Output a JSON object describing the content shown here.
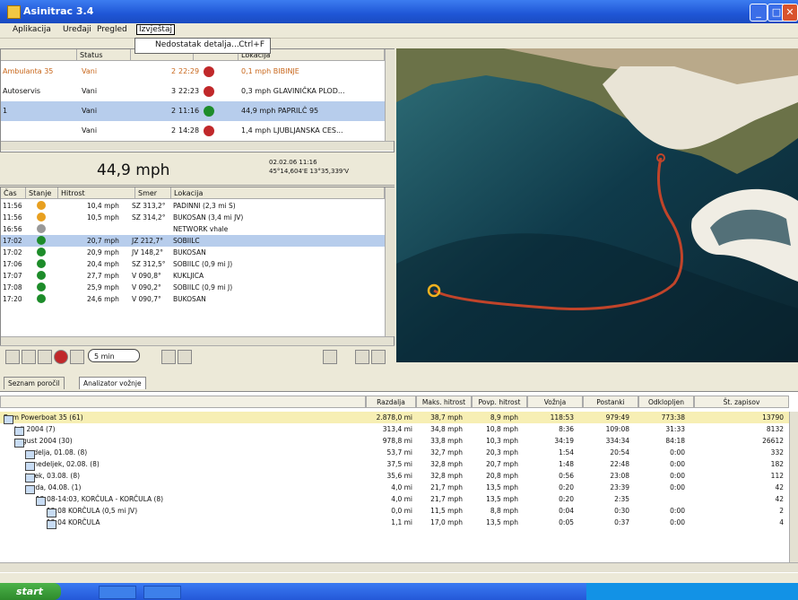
{
  "window": {
    "title": "Asinitrac 3.4"
  },
  "menu": [
    "Aplikacija",
    "Uređaji",
    "Pregled",
    "Izvještaj"
  ],
  "dropdown": {
    "item": "Nedostatak detalja...",
    "shortcut": "Ctrl+F"
  },
  "vehicles": {
    "columns": [
      "",
      "Status",
      "",
      "",
      "Lokacija"
    ],
    "rows": [
      {
        "name": "Ambulanta 35",
        "status": "Vani",
        "num": "2",
        "time": "22:29",
        "dot": "red",
        "location": "0,1 mph BIBINJE"
      },
      {
        "name": "Autoservis",
        "status": "Vani",
        "num": "3",
        "time": "22:23",
        "dot": "red",
        "location": "0,3 mph GLAVINIČKA PLOD..."
      },
      {
        "name": "1",
        "status": "Vani",
        "num": "2",
        "time": "11:16",
        "dot": "green",
        "location": "44,9 mph PAPRILČ 95"
      },
      {
        "name": "",
        "status": "Vani",
        "num": "2",
        "time": "14:28",
        "dot": "red",
        "location": "1,4 mph LJUBLJANSKA CES..."
      }
    ]
  },
  "speed_panel": {
    "speed": "44,9 mph",
    "datetime": "02.02.06 11:16",
    "coords": "45°14,604'E 13°35,339'V"
  },
  "log": {
    "columns": [
      "Čas",
      "Stanje",
      "Hitrost",
      "Smer",
      "Lokacija"
    ],
    "rows": [
      {
        "time": "11:56",
        "dot": "orange",
        "speed": "10,4 mph",
        "dir": "SZ 313,2°",
        "loc": "PADINNI (2,3 mi S)"
      },
      {
        "time": "11:56",
        "dot": "orange",
        "speed": "10,5 mph",
        "dir": "SZ 314,2°",
        "loc": "BUKOSAN (3,4 mi JV)"
      },
      {
        "time": "16:56",
        "dot": "gray",
        "speed": "",
        "dir": "",
        "loc": "NETWORK vhale"
      },
      {
        "time": "17:02",
        "dot": "green",
        "speed": "20,7 mph",
        "dir": "JZ 212,7°",
        "loc": "SOBIILC",
        "sel": true
      },
      {
        "time": "17:02",
        "dot": "green",
        "speed": "20,9 mph",
        "dir": "JV 148,2°",
        "loc": "BUKOSAN"
      },
      {
        "time": "17:06",
        "dot": "green",
        "speed": "20,4 mph",
        "dir": "SZ 312,5°",
        "loc": "SOBIILC (0,9 mi J)"
      },
      {
        "time": "17:07",
        "dot": "green",
        "speed": "27,7 mph",
        "dir": "V 090,8°",
        "loc": "KUKLJICA"
      },
      {
        "time": "17:08",
        "dot": "green",
        "speed": "25,9 mph",
        "dir": "V 090,2°",
        "loc": "SOBIILC (0,9 mi J)"
      },
      {
        "time": "17:20",
        "dot": "green",
        "speed": "24,6 mph",
        "dir": "V 090,7°",
        "loc": "BUKOSAN"
      }
    ]
  },
  "toolbar": {
    "select_value": "5 min"
  },
  "tabs": [
    "Seznam poročil",
    "Analizator vožnje"
  ],
  "report": {
    "columns": [
      "",
      "Razdalja",
      "Maks. hitrost",
      "Povp. hitrost",
      "Vožnja",
      "Postanki",
      "Odklopljen",
      "Št. zapisov"
    ],
    "rows": [
      {
        "label": "Bam Powerboat 35 (61)",
        "level": 0,
        "total": true,
        "vals": [
          "2.878,0 mi",
          "38,7 mph",
          "8,9 mph",
          "118:53",
          "979:49",
          "773:38",
          "13790"
        ]
      },
      {
        "label": "Juli 2004 (7)",
        "level": 1,
        "vals": [
          "313,4 mi",
          "34,8 mph",
          "10,8 mph",
          "8:36",
          "109:08",
          "31:33",
          "8132"
        ]
      },
      {
        "label": "avgust 2004 (30)",
        "level": 1,
        "vals": [
          "978,8 mi",
          "33,8 mph",
          "10,3 mph",
          "34:19",
          "334:34",
          "84:18",
          "26612"
        ]
      },
      {
        "label": "nedelja, 01.08. (8)",
        "level": 2,
        "vals": [
          "53,7 mi",
          "32,7 mph",
          "20,3 mph",
          "1:54",
          "20:54",
          "0:00",
          "332"
        ]
      },
      {
        "label": "ponedeljek, 02.08. (8)",
        "level": 2,
        "vals": [
          "37,5 mi",
          "32,8 mph",
          "20,7 mph",
          "1:48",
          "22:48",
          "0:00",
          "182"
        ]
      },
      {
        "label": "torek, 03.08. (8)",
        "level": 2,
        "vals": [
          "35,6 mi",
          "32,8 mph",
          "20,8 mph",
          "0:56",
          "23:08",
          "0:00",
          "112"
        ]
      },
      {
        "label": "sreda, 04.08. (1)",
        "level": 2,
        "vals": [
          "4,0 mi",
          "21,7 mph",
          "13,5 mph",
          "0:20",
          "23:39",
          "0:00",
          "42"
        ]
      },
      {
        "label": "12:08-14:03, KORČULA - KORČULA (8)",
        "level": 3,
        "vals": [
          "4,0 mi",
          "21,7 mph",
          "13,5 mph",
          "0:20",
          "2:35",
          "",
          "42"
        ]
      },
      {
        "label": "12:08 KORČULA (0,5 mi JV)",
        "level": 4,
        "vals": [
          "0,0 mi",
          "11,5 mph",
          "8,8 mph",
          "0:04",
          "0:30",
          "0:00",
          "2"
        ]
      },
      {
        "label": "12:04 KORČULA",
        "level": 4,
        "vals": [
          "1,1 mi",
          "17,0 mph",
          "13,5 mph",
          "0:05",
          "0:37",
          "0:00",
          "4"
        ]
      }
    ]
  },
  "taskbar": {
    "start_label": "start"
  },
  "colors": {
    "track": "#c1442a",
    "sea": "#0f3a4a",
    "land": "#6b7248",
    "titlebar": "#1f56d6"
  }
}
